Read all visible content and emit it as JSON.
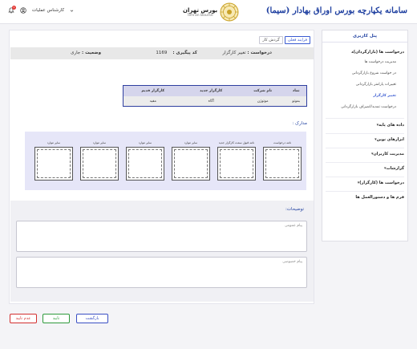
{
  "header": {
    "user_label": "کارشناس عملیات",
    "notification_count": "1",
    "logo_title": "بورس تهران",
    "logo_subtitle": "Tehran Bourse",
    "app_title": "سامانه یکپارچه بورس اوراق بهادار (سیما)"
  },
  "tabs": [
    {
      "label": "گردش کار"
    },
    {
      "label": "فرایند فعلی"
    }
  ],
  "request": {
    "request_label": "درخواست :",
    "request_value": "تغییر کارگزار",
    "tracking_label": "کد پیگیری :",
    "tracking_value": "1169",
    "status_label": "وضعیت :",
    "status_value": "جاری"
  },
  "change_table": {
    "headers": [
      "نماد",
      "نام شرکت",
      "کارگزار جدید",
      "کارگزار قدیم"
    ],
    "row": [
      "بموتو",
      "موتوژن",
      "آگاه",
      "مفید"
    ]
  },
  "documents": {
    "title": "مدارک :",
    "items": [
      {
        "label": "نامه درخواست"
      },
      {
        "label": "نامه قبول سمت کارگزار جدید"
      },
      {
        "label": "سایر موارد"
      },
      {
        "label": "سایر موارد"
      },
      {
        "label": "سایر موارد"
      },
      {
        "label": "سایر موارد"
      }
    ]
  },
  "descriptions": {
    "title": "توضیحات:",
    "public_placeholder": "پیام عمومی",
    "private_placeholder": "پیام خصوصی"
  },
  "actions": {
    "reject": "عدم تایید",
    "approve": "تایید",
    "back": "بازگشت"
  },
  "sidebar": {
    "title": "پنل کاربری",
    "group_requests": "درخواست ها (بازارگردان)",
    "sub_items": [
      {
        "label": "مدیریت درخواست ها"
      },
      {
        "label": "در خواست شروع بازارگردانی"
      },
      {
        "label": "تغییرات پارامتر بازارگردانی"
      },
      {
        "label": "تغییر کارگزار"
      },
      {
        "label": "درخواست تمدید/انصراف بازارگردانی"
      }
    ],
    "items": [
      {
        "label": "داده های پایه"
      },
      {
        "label": "ابزارهای نوین"
      },
      {
        "label": "مدیریت کاربران"
      },
      {
        "label": "گزارشات"
      },
      {
        "label": "درخواست ها (کارگزار)"
      },
      {
        "label": "فرم ها و دستورالعمل ها"
      }
    ]
  },
  "colors": {
    "accent": "#1e3fa0",
    "reject": "#d32f2f",
    "approve": "#2e9a3c",
    "back": "#3a4fc4"
  }
}
